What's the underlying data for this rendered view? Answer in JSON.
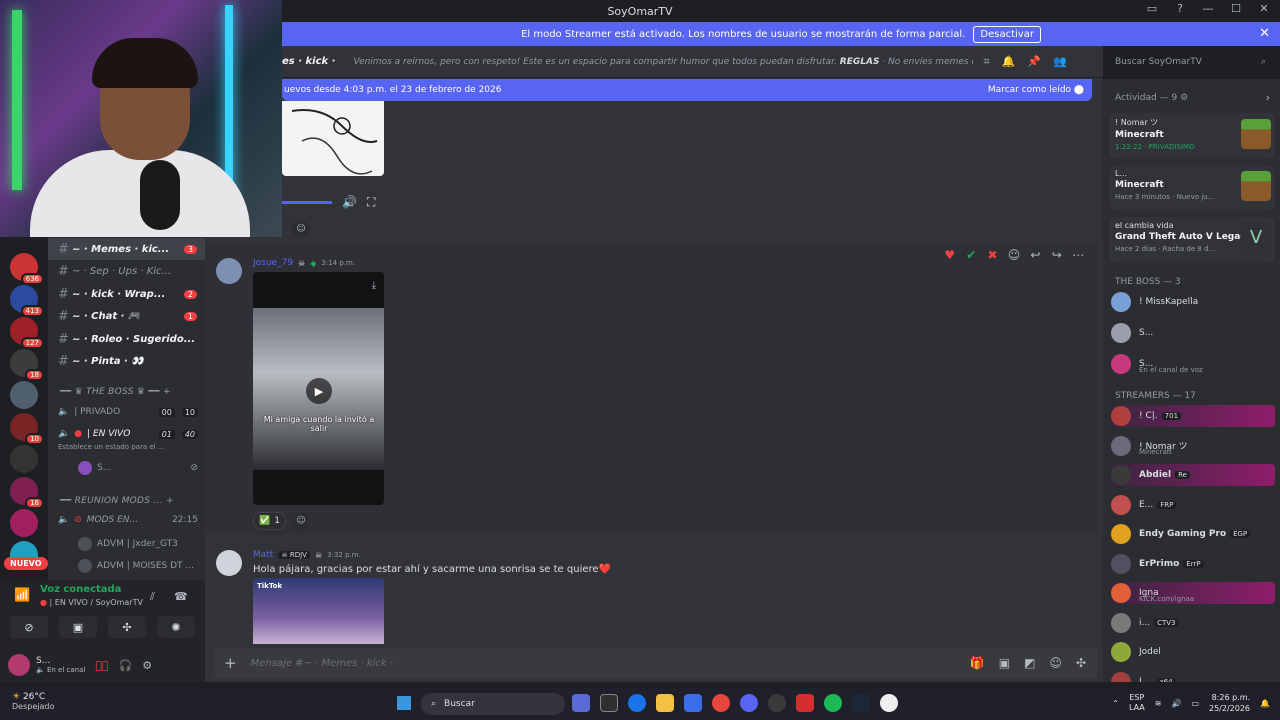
{
  "window": {
    "title": "SoyOmarTV"
  },
  "banner": {
    "text": "El modo Streamer está activado. Los nombres de usuario se mostrarán de forma parcial.",
    "button": "Desactivar"
  },
  "header": {
    "channel": "es · kick ·",
    "topic_lead": "Venimos a reírnos, pero con respeto! Este es un espacio para compartir humor que todos puedan disfrutar.",
    "topic_rules": "REGLAS",
    "topic_tail": "· No envíes memes que contengan m...",
    "search_placeholder": "Buscar SoyOmarTV"
  },
  "newbar": {
    "text": "uevos desde 4:03 p.m. el 23 de febrero de 2026",
    "action": "Marcar como leído"
  },
  "servers": [
    {
      "badge": "636",
      "color": "#c33"
    },
    {
      "badge": "413",
      "color": "#2b4aa0"
    },
    {
      "badge": "127",
      "color": "#a0202a"
    },
    {
      "badge": "18",
      "color": "#3c3c3c"
    },
    {
      "badge": "",
      "color": "#506070"
    },
    {
      "badge": "10",
      "color": "#7a2525"
    },
    {
      "badge": "",
      "color": "#333"
    },
    {
      "badge": "16",
      "color": "#802050"
    },
    {
      "badge": "",
      "color": "#a02060"
    },
    {
      "badge": "",
      "color": "#20a0c0"
    }
  ],
  "nuevo": "NUEVO",
  "channels": [
    {
      "name": "~ · Memes · kic...",
      "count": "3",
      "bold": true,
      "selected": true
    },
    {
      "name": "~ · Sep · Ups · Kic...",
      "count": "",
      "bold": false,
      "selected": false
    },
    {
      "name": "~ · kick · Wrap...",
      "count": "2",
      "bold": true,
      "selected": false
    },
    {
      "name": "~ · Chat · 🎮",
      "count": "1",
      "bold": true,
      "selected": false
    },
    {
      "name": "~ · Roleo · Sugerido...",
      "count": "",
      "bold": true,
      "selected": false
    },
    {
      "name": "~ · Pinta · 👀",
      "count": "",
      "bold": true,
      "selected": false
    }
  ],
  "categories": {
    "boss": "THE BOSS",
    "reunion": "REUNION MODS ..."
  },
  "voice_channels": {
    "privado": "| PRIVADO",
    "privado_a": "00",
    "privado_b": "10",
    "envivo": "| EN VIVO",
    "envivo_a": "01",
    "envivo_b": "40",
    "envivo_status": "Establece un estado para el ...",
    "user_s": "S...",
    "mods": "MODS EN...",
    "mods_time": "22:15",
    "advm1": "ADVM | Jxder_GT3",
    "advm2": "ADVM | MOISES DT ..."
  },
  "voicepanel": {
    "title": "Voz conectada",
    "channel": "| EN VIVO / SoyOmarTV"
  },
  "userbar": {
    "name": "S...",
    "status": "En el canal"
  },
  "messages": {
    "msg1_author": "Josue_79",
    "msg1_time": "3:14 p.m.",
    "video_caption": "Mi amiga cuando la invitó a salir",
    "reaction_count": "1",
    "msg2_author": "Matt",
    "msg2_tag": "RDJV",
    "msg2_time": "3:32 p.m.",
    "msg2_text": "Hola pájara, gracias por estar ahí y sacarme una sonrisa se te quiere❤️",
    "tiktok_label": "TikTok"
  },
  "composer": {
    "placeholder": "Mensaje #~ · Memes · kick ·"
  },
  "right": {
    "activity_head": "Actividad — 9",
    "activities": [
      {
        "user": "! Nomar ツ",
        "game": "Minecraft",
        "status": "1:22:22 · PRIVADISIMO",
        "icon": "minecraft"
      },
      {
        "user": "L...",
        "game": "Minecraft",
        "status": "Hace 3 minutos · Nuevo ju...",
        "icon": "minecraft"
      },
      {
        "user": "el cambia vida",
        "game": "Grand Theft Auto V Legacy",
        "status": "Hace 2 días · Racha de 8 d...",
        "icon": "gta"
      }
    ],
    "boss_head": "THE BOSS — 3",
    "boss_members": [
      {
        "name": "! MissKapella",
        "sub": ""
      },
      {
        "name": "S...",
        "sub": ""
      },
      {
        "name": "S...",
        "sub": "En el canal de voz"
      }
    ],
    "streamers_head": "STREAMERS — 17",
    "streamers": [
      {
        "name": "! C|.",
        "tag": "701",
        "sub": ""
      },
      {
        "name": "! Nomar ツ",
        "tag": "",
        "sub": "Minecraft"
      },
      {
        "name": "Abdiel",
        "tag": "Re",
        "sub": ""
      },
      {
        "name": "E...",
        "tag": "FRP",
        "sub": ""
      },
      {
        "name": "Endy Gaming Pro",
        "tag": "EGP",
        "sub": ""
      },
      {
        "name": "ErPrimo",
        "tag": "ErrP",
        "sub": ""
      },
      {
        "name": "Igna",
        "tag": "",
        "sub": "KICK.com/ignaa"
      },
      {
        "name": "i...",
        "tag": "CTV3",
        "sub": ""
      },
      {
        "name": "Jodel",
        "tag": "",
        "sub": ""
      },
      {
        "name": "L...",
        "tag": "x64",
        "sub": ""
      }
    ]
  },
  "taskbar": {
    "temp": "26°C",
    "weather": "Despejado",
    "search": "Buscar",
    "lang1": "ESP",
    "lang2": "LAA",
    "time": "8:26 p.m.",
    "date": "25/2/2026"
  }
}
